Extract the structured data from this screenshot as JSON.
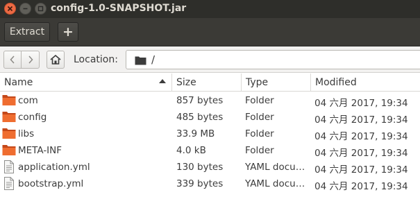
{
  "window": {
    "title": "config-1.0-SNAPSHOT.jar"
  },
  "toolbar": {
    "extract_label": "Extract",
    "add_label": "+"
  },
  "location": {
    "label": "Location:",
    "path": "/"
  },
  "columns": {
    "name": "Name",
    "size": "Size",
    "type": "Type",
    "modified": "Modified"
  },
  "files": [
    {
      "name": "com",
      "size": "857 bytes",
      "type": "Folder",
      "modified": "04 六月 2017, 19:34",
      "icon": "folder-icon"
    },
    {
      "name": "config",
      "size": "485 bytes",
      "type": "Folder",
      "modified": "04 六月 2017, 19:34",
      "icon": "folder-icon"
    },
    {
      "name": "libs",
      "size": "33.9 MB",
      "type": "Folder",
      "modified": "04 六月 2017, 19:34",
      "icon": "folder-icon"
    },
    {
      "name": "META-INF",
      "size": "4.0 kB",
      "type": "Folder",
      "modified": "04 六月 2017, 19:34",
      "icon": "folder-icon"
    },
    {
      "name": "application.yml",
      "size": "130 bytes",
      "type": "YAML docu…",
      "modified": "04 六月 2017, 19:34",
      "icon": "document-icon"
    },
    {
      "name": "bootstrap.yml",
      "size": "339 bytes",
      "type": "YAML docu…",
      "modified": "04 六月 2017, 19:34",
      "icon": "document-icon"
    }
  ],
  "colors": {
    "titlebar": "#2e2e2a",
    "toolbar": "#3b3a36",
    "close": "#ec6a44",
    "folder": "#e8642a"
  }
}
